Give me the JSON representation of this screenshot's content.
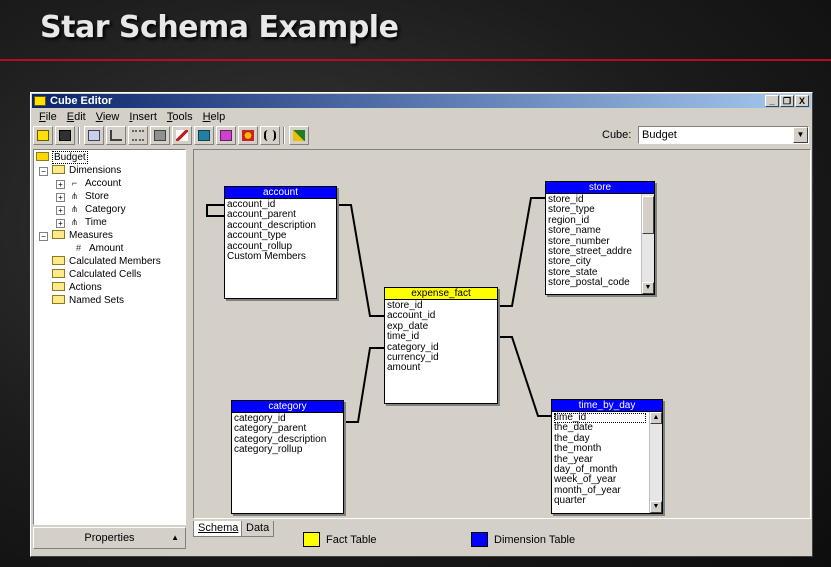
{
  "slide": {
    "title": "Star Schema Example"
  },
  "window": {
    "title": "Cube Editor",
    "buttons": {
      "minimize": "_",
      "restore": "❐",
      "close": "X"
    }
  },
  "menu": [
    "File",
    "Edit",
    "View",
    "Insert",
    "Tools",
    "Help"
  ],
  "toolbar": {
    "cube_label": "Cube:",
    "cube_value": "Budget"
  },
  "tree": {
    "root": "Budget",
    "dimensions_label": "Dimensions",
    "dimensions": [
      "Account",
      "Store",
      "Category",
      "Time"
    ],
    "measures_label": "Measures",
    "measures": [
      "Amount"
    ],
    "folders": [
      "Calculated Members",
      "Calculated Cells",
      "Actions",
      "Named Sets"
    ]
  },
  "properties_label": "Properties",
  "tables": {
    "account": {
      "name": "account",
      "fields": [
        "account_id",
        "account_parent",
        "account_description",
        "account_type",
        "account_rollup",
        "Custom Members"
      ]
    },
    "store": {
      "name": "store",
      "fields": [
        "store_id",
        "store_type",
        "region_id",
        "store_name",
        "store_number",
        "store_street_addre",
        "store_city",
        "store_state",
        "store_postal_code"
      ]
    },
    "expense_fact": {
      "name": "expense_fact",
      "fields": [
        "store_id",
        "account_id",
        "exp_date",
        "time_id",
        "category_id",
        "currency_id",
        "amount"
      ]
    },
    "category": {
      "name": "category",
      "fields": [
        "category_id",
        "category_parent",
        "category_description",
        "category_rollup"
      ]
    },
    "time_by_day": {
      "name": "time_by_day",
      "fields": [
        "time_id",
        "the_date",
        "the_day",
        "the_month",
        "the_year",
        "day_of_month",
        "week_of_year",
        "month_of_year",
        "quarter"
      ]
    }
  },
  "tabs": [
    "Schema",
    "Data"
  ],
  "legend": {
    "fact_label": "Fact Table",
    "fact_color": "#ffff00",
    "dimension_label": "Dimension Table",
    "dimension_color": "#0000ff"
  }
}
